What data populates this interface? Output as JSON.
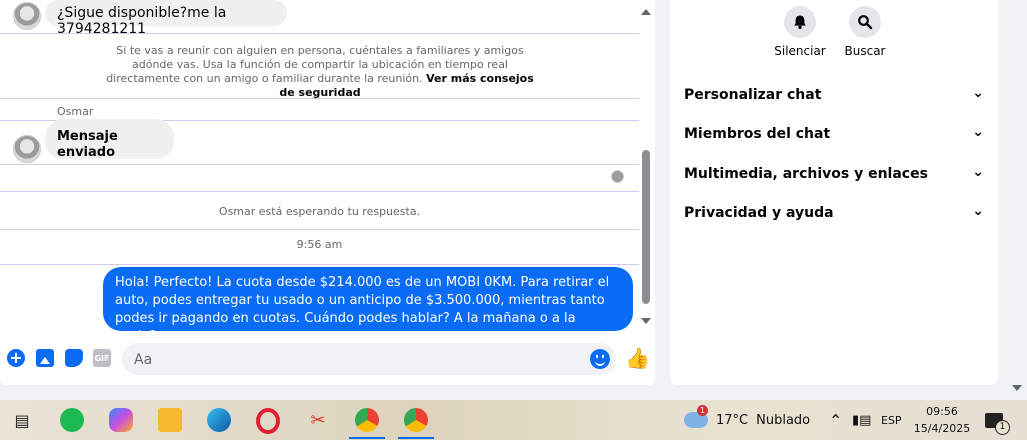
{
  "chat": {
    "messages": {
      "first_in": "¿Sigue disponible?me la 3794281211",
      "safety_text": "Si te vas a reunir con alguien en persona, cuéntales a familiares y amigos adónde vas. Usa la función de compartir la ubicación en tiempo real directamente con un amigo o familiar durante la reunión.",
      "safety_link": "Ver más consejos de seguridad",
      "sender_name": "Osmar",
      "second_in": "Mensaje enviado",
      "waiting_notice": "Osmar está esperando tu respuesta.",
      "timestamp": "9:56 am",
      "outgoing": "Hola! Perfecto! La cuota desde $214.000 es de un MOBI 0KM. Para retirar el auto, podes entregar tu usado o un anticipo de $3.500.000, mientras tanto podes ir pagando en cuotas. Cuándo podes hablar? A la mañana o a la tarde?"
    },
    "composer": {
      "placeholder": "Aa",
      "gif_label": "GIF"
    },
    "scroll": {
      "thumb_fraction_start": 0.45,
      "thumb_fraction_size": 0.46
    }
  },
  "panel": {
    "actions": [
      {
        "label": "Silenciar",
        "icon": "bell-icon"
      },
      {
        "label": "Buscar",
        "icon": "search-icon"
      }
    ],
    "sections": [
      {
        "label": "Personalizar chat"
      },
      {
        "label": "Miembros del chat"
      },
      {
        "label": "Multimedia, archivos y enlaces"
      },
      {
        "label": "Privacidad y ayuda"
      }
    ]
  },
  "taskbar": {
    "weather_temp": "17°C",
    "weather_desc": "Nublado",
    "weather_badge": "1",
    "language": "ESP",
    "time": "09:56",
    "date": "15/4/2025",
    "notification_count": "1"
  },
  "colors": {
    "accent": "#0a6cf5",
    "bubble_in": "#f0f0f0",
    "divider": "#d6c8ee"
  }
}
